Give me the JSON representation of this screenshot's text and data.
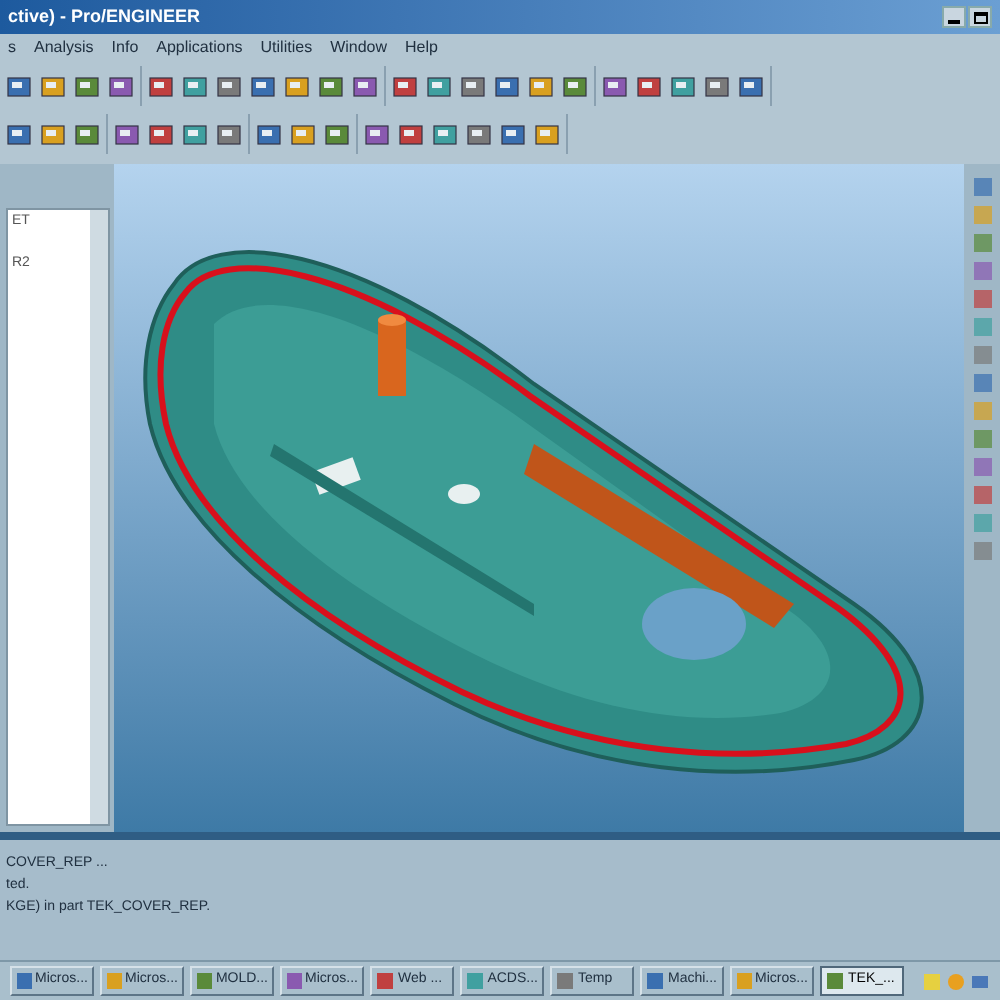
{
  "window": {
    "title": "ctive) - Pro/ENGINEER"
  },
  "menu": [
    {
      "label": "s"
    },
    {
      "label": "Analysis"
    },
    {
      "label": "Info"
    },
    {
      "label": "Applications"
    },
    {
      "label": "Utilities"
    },
    {
      "label": "Window"
    },
    {
      "label": "Help"
    }
  ],
  "model_tree": {
    "items": [
      {
        "label": "ET"
      },
      {
        "label": "R2"
      }
    ]
  },
  "messages": [
    "COVER_REP ...",
    "ted.",
    "KGE) in part TEK_COVER_REP."
  ],
  "taskbar": [
    {
      "label": "Micros...",
      "selected": false
    },
    {
      "label": "Micros...",
      "selected": false
    },
    {
      "label": "MOLD...",
      "selected": false
    },
    {
      "label": "Micros...",
      "selected": false
    },
    {
      "label": "Web ...",
      "selected": false
    },
    {
      "label": "ACDS...",
      "selected": false
    },
    {
      "label": "Temp",
      "selected": false
    },
    {
      "label": "Machi...",
      "selected": false
    },
    {
      "label": "Micros...",
      "selected": false
    },
    {
      "label": "TEK_...",
      "selected": true
    }
  ]
}
